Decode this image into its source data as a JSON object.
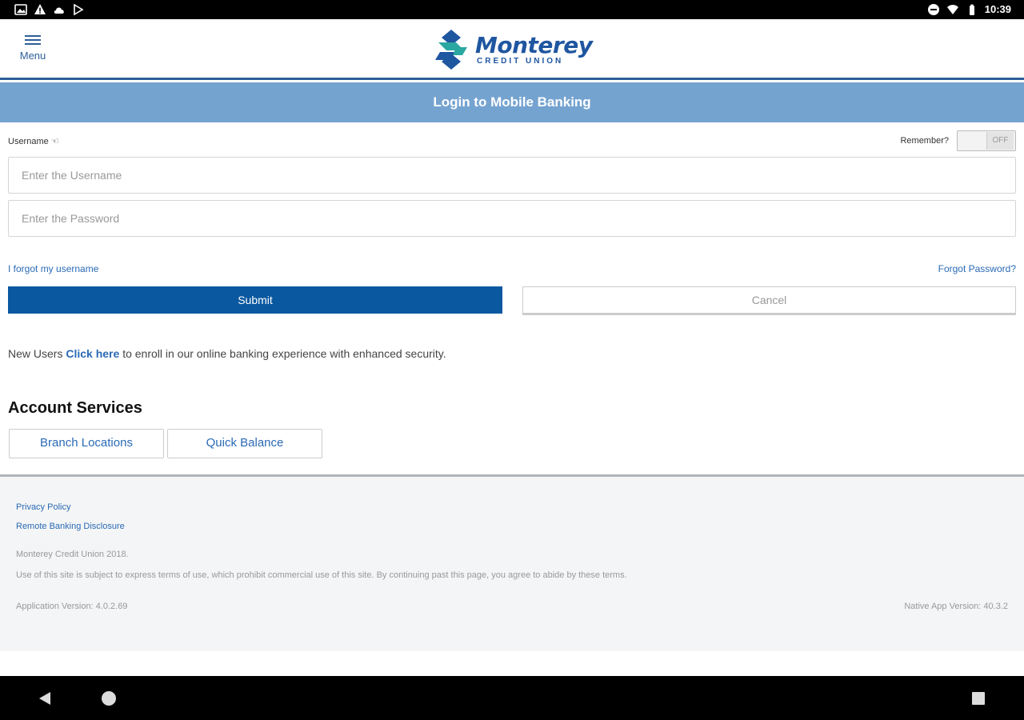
{
  "status_bar": {
    "time": "10:39",
    "left_icons": [
      "gallery-icon",
      "warning-icon",
      "cloud-icon",
      "play-store-icon"
    ],
    "right_icons": [
      "do-not-disturb-icon",
      "wifi-icon",
      "battery-icon"
    ]
  },
  "header": {
    "menu_label": "Menu",
    "logo_name": "Monterey",
    "logo_sub": "CREDIT UNION"
  },
  "title_bar": {
    "title": "Login to Mobile Banking"
  },
  "login": {
    "username_label": "Username ☜",
    "remember_label": "Remember?",
    "remember_toggle": "OFF",
    "username_placeholder": "Enter the Username",
    "username_value": "",
    "password_placeholder": "Enter the Password",
    "password_value": "",
    "forgot_username": "I forgot my username",
    "forgot_password": "Forgot Password?",
    "submit_label": "Submit",
    "cancel_label": "Cancel"
  },
  "enroll": {
    "prefix": "New Users",
    "link": "Click here",
    "suffix": "to enroll in our online banking experience with enhanced security."
  },
  "account_services": {
    "title": "Account Services",
    "buttons": [
      "Branch Locations",
      "Quick Balance"
    ]
  },
  "footer": {
    "privacy": "Privacy Policy",
    "remote_disclosure": "Remote Banking Disclosure",
    "copyright": "Monterey Credit Union 2018.",
    "terms": "Use of this site is subject to express terms of use, which prohibit commercial use of this site. By continuing past this page, you agree to abide by these terms.",
    "app_version": "Application Version: 4.0.2.69",
    "native_version": "Native App Version: 40.3.2"
  },
  "colors": {
    "brand_blue": "#1f56a0",
    "title_bar": "#75a3d0",
    "submit": "#0a58a0",
    "link": "#2a6ab5"
  }
}
